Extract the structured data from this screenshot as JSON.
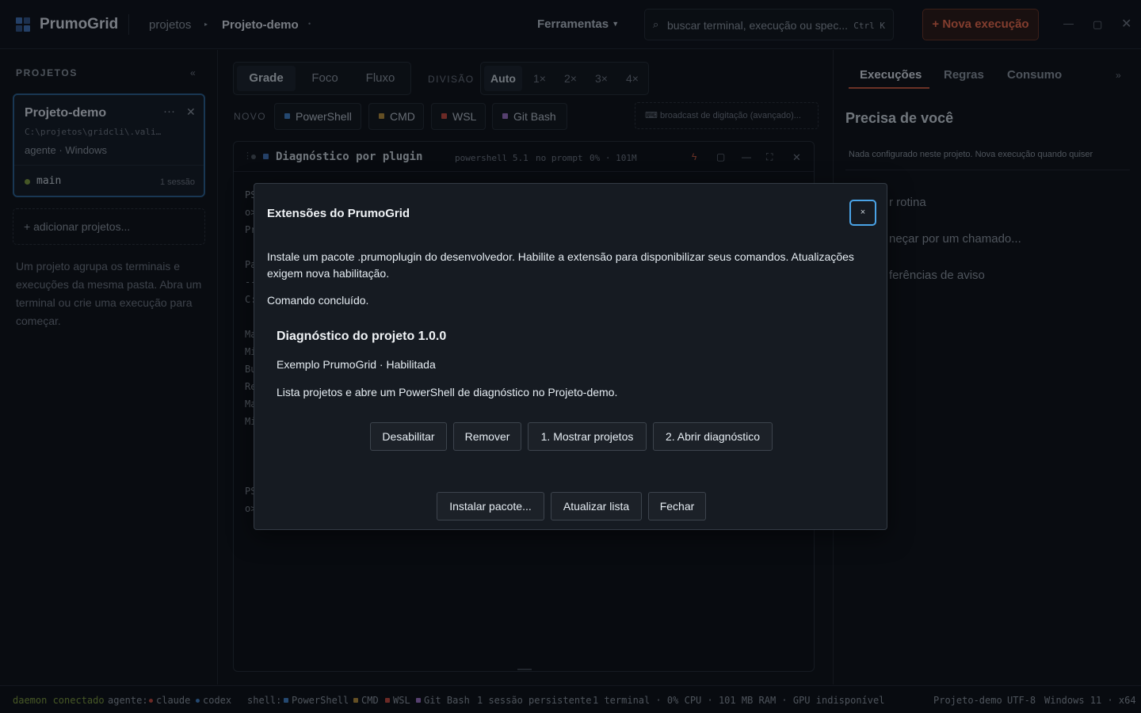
{
  "app": {
    "name": "PrumoGrid"
  },
  "breadcrumb": {
    "root": "projetos",
    "current": "Projeto-demo"
  },
  "titlebar": {
    "tools_label": "Ferramentas",
    "search_placeholder": "buscar terminal, execução ou spec...",
    "search_shortcut": "Ctrl K",
    "new_run_label": "+ Nova execução"
  },
  "sidebar": {
    "title": "PROJETOS",
    "project": {
      "name": "Projeto-demo",
      "path": "C:\\projetos\\gridcli\\.vali…",
      "meta": "agente · Windows",
      "branch": "main",
      "sessions": "1 sessão"
    },
    "add_label": "+ adicionar projetos...",
    "help": "Um projeto agrupa os terminais e execuções da mesma pasta. Abra um terminal ou crie uma execução para começar."
  },
  "main": {
    "views": [
      "Grade",
      "Foco",
      "Fluxo"
    ],
    "division_label": "DIVISÃO",
    "divisions": [
      "Auto",
      "1×",
      "2×",
      "3×",
      "4×"
    ],
    "new_label": "NOVO",
    "shells": [
      {
        "label": "PowerShell",
        "color": "#3f7fc4"
      },
      {
        "label": "CMD",
        "color": "#b38a3a"
      },
      {
        "label": "WSL",
        "color": "#c2473c"
      },
      {
        "label": "Git Bash",
        "color": "#9a6fc2"
      }
    ],
    "broadcast": "broadcast de digitação (avançado)...",
    "terminal": {
      "title": "Diagnóstico por plugin",
      "shell": "powershell 5.1",
      "prompt_state": "no prompt",
      "usage": "0% · 101M",
      "lines": [
        "PS",
        "o>",
        "Pr",
        "",
        "Pa",
        "--",
        "C:",
        "",
        "Ma",
        "Mi",
        "Bu",
        "Re",
        "Ma",
        "Mi",
        "",
        "",
        "",
        "PS",
        "o>"
      ]
    }
  },
  "right": {
    "tabs": [
      "Execuções",
      "Regras",
      "Consumo"
    ],
    "need_title": "Precisa de você",
    "info": "Nada configurado neste projeto. Nova execução quando quiser",
    "items": [
      "r rotina",
      "neçar por um chamado...",
      "ferências de aviso"
    ]
  },
  "statusbar": {
    "daemon": "daemon conectado",
    "agent_label": "agente:",
    "agents": [
      {
        "label": "claude",
        "color": "#c2473c"
      },
      {
        "label": "codex",
        "color": "#3f7fc4"
      }
    ],
    "shell_label": "shell:",
    "shells": [
      {
        "label": "PowerShell",
        "color": "#3f7fc4"
      },
      {
        "label": "CMD",
        "color": "#b38a3a"
      },
      {
        "label": "WSL",
        "color": "#c2473c"
      },
      {
        "label": "Git Bash",
        "color": "#9a6fc2"
      }
    ],
    "persistent": "1 sessão persistente",
    "stats": "1 terminal · 0% CPU · 101 MB RAM · GPU indisponível",
    "project": "Projeto-demo",
    "encoding": "UTF-8",
    "platform": "Windows 11 · x64"
  },
  "modal": {
    "title": "Extensões do PrumoGrid",
    "close": "×",
    "description": "Instale um pacote .prumoplugin do desenvolvedor. Habilite a extensão para disponibilizar seus comandos. Atualizações exigem nova habilitação.",
    "status": "Comando concluído.",
    "extension": {
      "name": "Diagnóstico do projeto 1.0.0",
      "subtitle": "Exemplo PrumoGrid · Habilitada",
      "description": "Lista projetos e abre um PowerShell de diagnóstico no Projeto-demo.",
      "actions": [
        "Desabilitar",
        "Remover",
        "1. Mostrar projetos",
        "2. Abrir diagnóstico"
      ]
    },
    "footer": [
      "Instalar pacote...",
      "Atualizar lista",
      "Fechar"
    ]
  }
}
